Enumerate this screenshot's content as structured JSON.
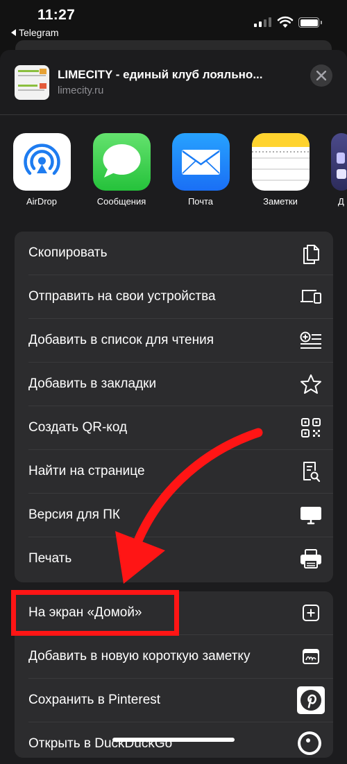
{
  "status_bar": {
    "time": "11:27",
    "back_app": "Telegram"
  },
  "header": {
    "title": "LIMECITY - единый клуб лояльно...",
    "domain": "limecity.ru"
  },
  "apps": [
    {
      "label": "AirDrop",
      "icon": "airdrop-icon"
    },
    {
      "label": "Сообщения",
      "icon": "messages-icon"
    },
    {
      "label": "Почта",
      "icon": "mail-icon"
    },
    {
      "label": "Заметки",
      "icon": "notes-icon"
    },
    {
      "label": "Д",
      "icon": "partial-app-icon"
    }
  ],
  "actions_group1": [
    {
      "label": "Скопировать",
      "icon": "copy-icon"
    },
    {
      "label": "Отправить на свои устройства",
      "icon": "devices-icon"
    },
    {
      "label": "Добавить в список для чтения",
      "icon": "reading-list-icon"
    },
    {
      "label": "Добавить в закладки",
      "icon": "star-icon"
    },
    {
      "label": "Создать QR-код",
      "icon": "qr-code-icon"
    },
    {
      "label": "Найти на странице",
      "icon": "find-on-page-icon"
    },
    {
      "label": "Версия для ПК",
      "icon": "desktop-icon"
    },
    {
      "label": "Печать",
      "icon": "print-icon"
    }
  ],
  "actions_group2": [
    {
      "label": "На экран «Домой»",
      "icon": "add-square-icon"
    },
    {
      "label": "Добавить в новую короткую заметку",
      "icon": "quick-note-icon"
    },
    {
      "label": "Сохранить в Pinterest",
      "icon": "pinterest-icon"
    },
    {
      "label": "Открыть в DuckDuckGo",
      "icon": "duckduckgo-icon"
    }
  ],
  "colors": {
    "highlight": "#ff1515",
    "sheet": "#1c1c1e",
    "row_group": "#2c2c2e"
  }
}
